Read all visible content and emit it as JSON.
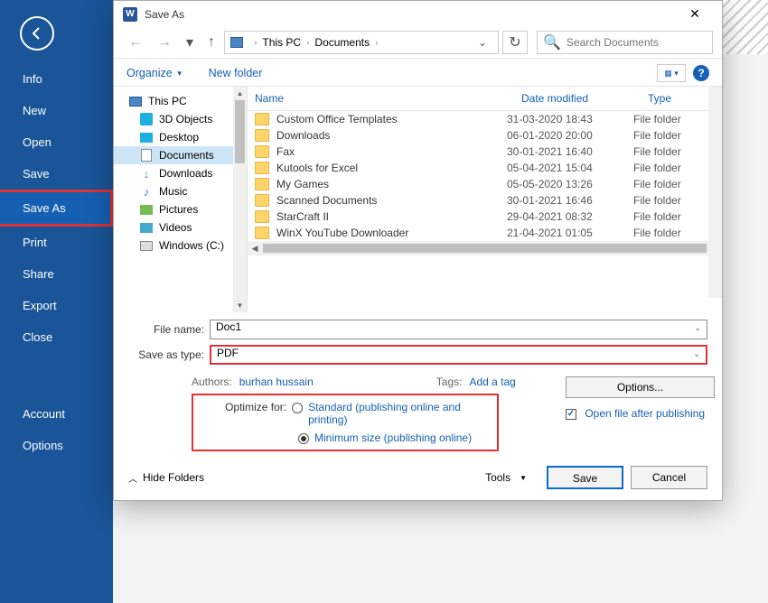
{
  "sidebar": {
    "items": [
      {
        "label": "Info"
      },
      {
        "label": "New"
      },
      {
        "label": "Open"
      },
      {
        "label": "Save"
      },
      {
        "label": "Save As"
      },
      {
        "label": "Print"
      },
      {
        "label": "Share"
      },
      {
        "label": "Export"
      },
      {
        "label": "Close"
      }
    ],
    "bottom": [
      {
        "label": "Account"
      },
      {
        "label": "Options"
      }
    ]
  },
  "dialog": {
    "title": "Save As",
    "breadcrumb": {
      "root": "This PC",
      "folder": "Documents"
    },
    "search_placeholder": "Search Documents",
    "organize": "Organize",
    "newfolder": "New folder",
    "help": "?",
    "tree": [
      {
        "label": "This PC",
        "icon": "pc"
      },
      {
        "label": "3D Objects",
        "icon": "3d"
      },
      {
        "label": "Desktop",
        "icon": "desk"
      },
      {
        "label": "Documents",
        "icon": "doc",
        "selected": true
      },
      {
        "label": "Downloads",
        "icon": "dl"
      },
      {
        "label": "Music",
        "icon": "music"
      },
      {
        "label": "Pictures",
        "icon": "pic"
      },
      {
        "label": "Videos",
        "icon": "vid"
      },
      {
        "label": "Windows (C:)",
        "icon": "disk"
      }
    ],
    "columns": {
      "name": "Name",
      "date": "Date modified",
      "type": "Type"
    },
    "rows": [
      {
        "name": "Custom Office Templates",
        "date": "31-03-2020 18:43",
        "type": "File folder"
      },
      {
        "name": "Downloads",
        "date": "06-01-2020 20:00",
        "type": "File folder"
      },
      {
        "name": "Fax",
        "date": "30-01-2021 16:40",
        "type": "File folder"
      },
      {
        "name": "Kutools for Excel",
        "date": "05-04-2021 15:04",
        "type": "File folder"
      },
      {
        "name": "My Games",
        "date": "05-05-2020 13:26",
        "type": "File folder"
      },
      {
        "name": "Scanned Documents",
        "date": "30-01-2021 16:46",
        "type": "File folder"
      },
      {
        "name": "StarCraft II",
        "date": "29-04-2021 08:32",
        "type": "File folder"
      },
      {
        "name": "WinX YouTube Downloader",
        "date": "21-04-2021 01:05",
        "type": "File folder"
      }
    ],
    "filename_label": "File name:",
    "filename_value": "Doc1",
    "saveastype_label": "Save as type:",
    "saveastype_value": "PDF",
    "authors_label": "Authors:",
    "authors_value": "burhan hussain",
    "tags_label": "Tags:",
    "tags_value": "Add a tag",
    "optimize_label": "Optimize for:",
    "optimize_standard": "Standard (publishing online and printing)",
    "optimize_minimum": "Minimum size (publishing online)",
    "options_btn": "Options...",
    "openfile_label": "Open file after publishing",
    "hide_folders": "Hide Folders",
    "tools": "Tools",
    "save_btn": "Save",
    "cancel_btn": "Cancel"
  }
}
